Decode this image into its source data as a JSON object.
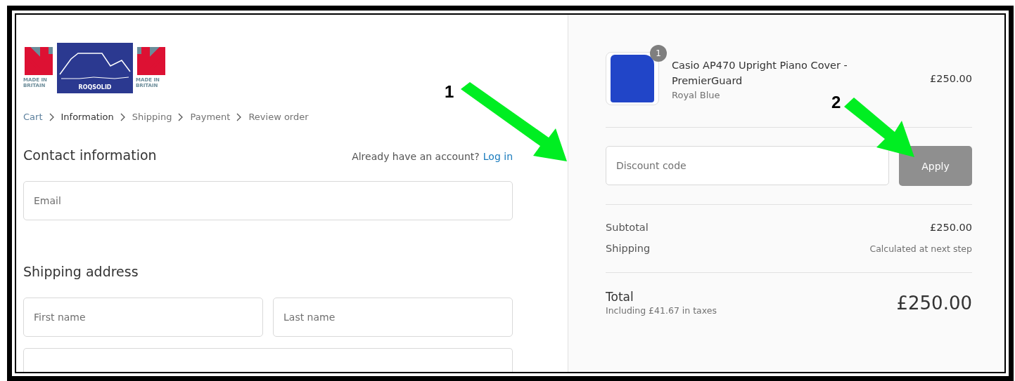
{
  "logo": {
    "badge_left": "MADE IN BRITAIN",
    "brand": "ROQSOLID",
    "badge_right": "MADE IN BRITAIN"
  },
  "breadcrumb": [
    {
      "label": "Cart",
      "selected": false,
      "completed": true
    },
    {
      "label": "Information",
      "selected": true,
      "completed": false
    },
    {
      "label": "Shipping",
      "selected": false,
      "completed": false
    },
    {
      "label": "Payment",
      "selected": false,
      "completed": false
    },
    {
      "label": "Review order",
      "selected": false,
      "completed": false
    }
  ],
  "contact": {
    "title": "Contact information",
    "account_prompt": "Already have an account?",
    "login_link": "Log in",
    "email_placeholder": "Email"
  },
  "shipping_address": {
    "title": "Shipping address",
    "first_name_placeholder": "First name",
    "last_name_placeholder": "Last name"
  },
  "order": {
    "product": {
      "quantity": "1",
      "name": "Casio AP470 Upright Piano Cover - PremierGuard",
      "variant": "Royal Blue",
      "price": "£250.00"
    },
    "discount": {
      "placeholder": "Discount code",
      "button": "Apply",
      "disabled": true
    },
    "lines": [
      {
        "label": "Subtotal",
        "value": "£250.00",
        "kind": "amount"
      },
      {
        "label": "Shipping",
        "value": "Calculated at next step",
        "kind": "note"
      }
    ],
    "total": {
      "label": "Total",
      "taxes": "Including £41.67 in taxes",
      "value": "£250.00"
    }
  },
  "annotations": [
    {
      "label": "1"
    },
    {
      "label": "2"
    }
  ]
}
